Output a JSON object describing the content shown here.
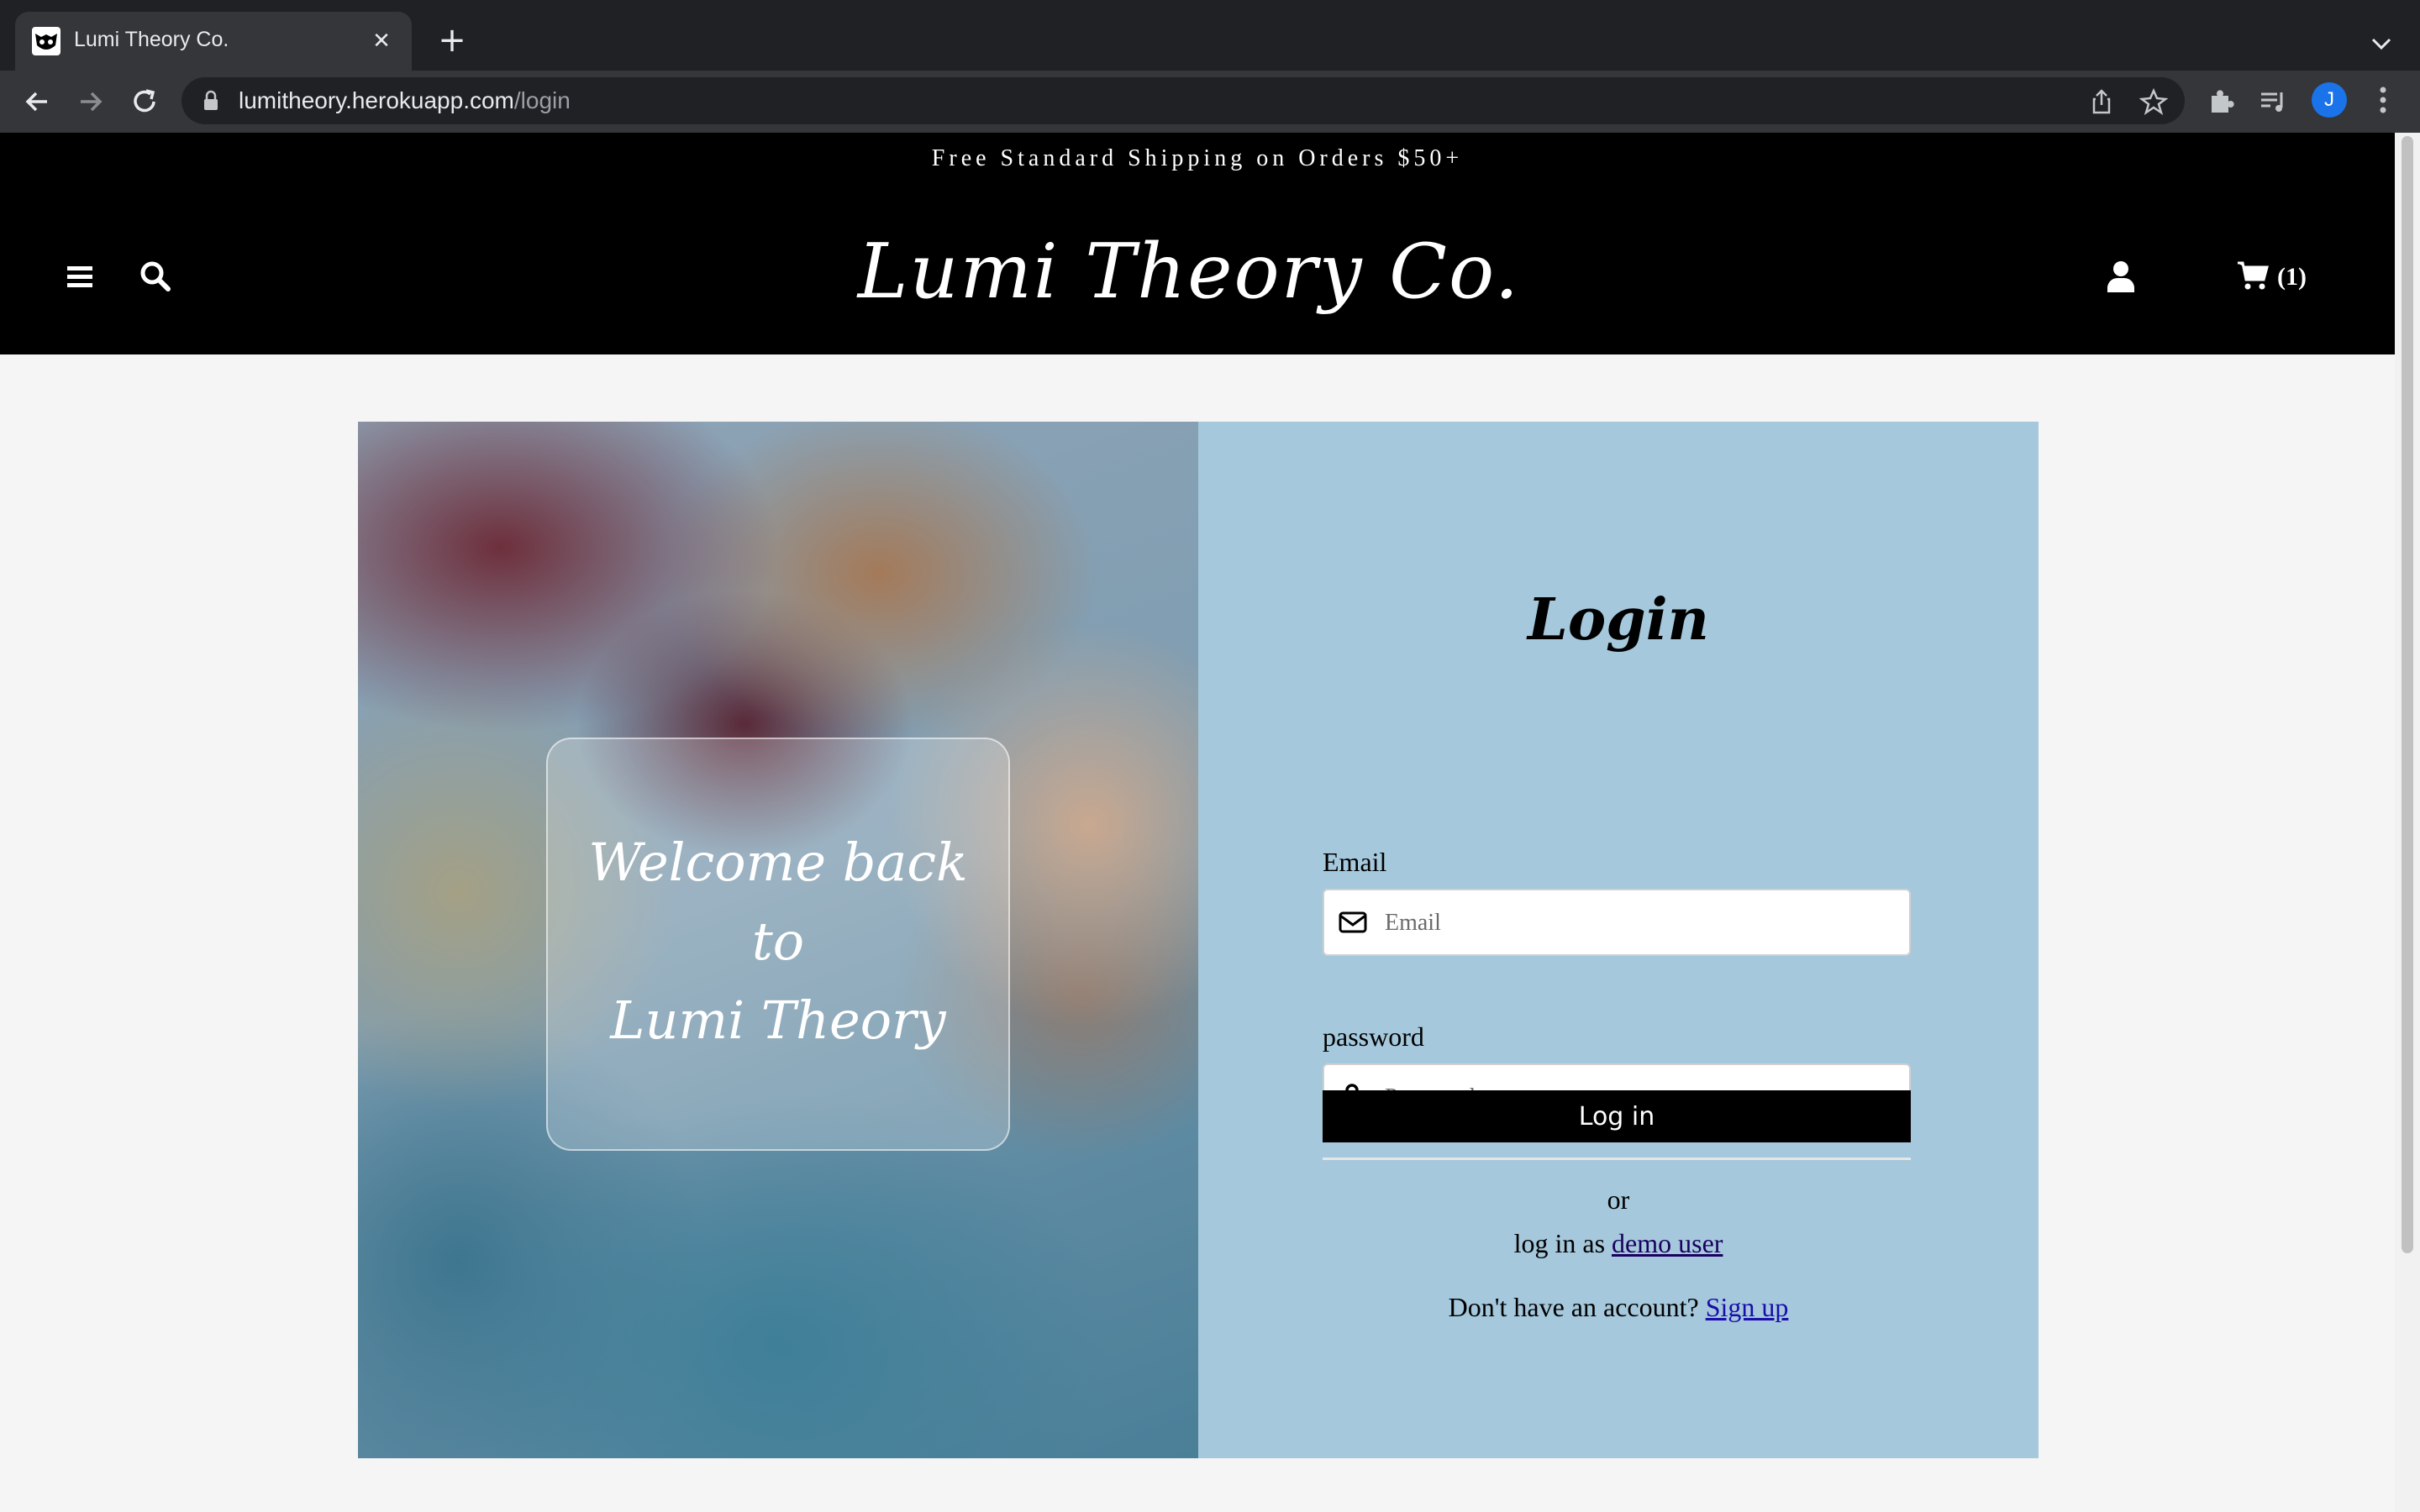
{
  "browser": {
    "tab_title": "Lumi Theory Co.",
    "url_host": "lumitheory.herokuapp.com",
    "url_path": "/login",
    "profile_initial": "J"
  },
  "site": {
    "promo": "Free Standard Shipping on Orders $50+",
    "brand": "Lumi Theory Co.",
    "cart_count": "(1)"
  },
  "login": {
    "welcome_line1": "Welcome back",
    "welcome_line2": "to",
    "welcome_line3": "Lumi Theory",
    "title": "Login",
    "email_label": "Email",
    "email_placeholder": "Email",
    "password_label": "password",
    "password_placeholder": "Password",
    "login_button": "Log in",
    "or_text": "or",
    "demo_prefix": "log in as",
    "demo_link": "demo user",
    "signup_prefix": "Don't have an account?",
    "signup_link": "Sign up"
  },
  "icons": {
    "favicon": "owl-icon",
    "email": "envelope-icon",
    "password": "unlock-icon",
    "user": "user-icon",
    "cart": "cart-icon",
    "search": "search-icon",
    "menu": "hamburger-icon"
  },
  "colors": {
    "form_bg": "#a5c8dc",
    "header_bg": "#000000",
    "page_bg": "#f5f5f5"
  }
}
